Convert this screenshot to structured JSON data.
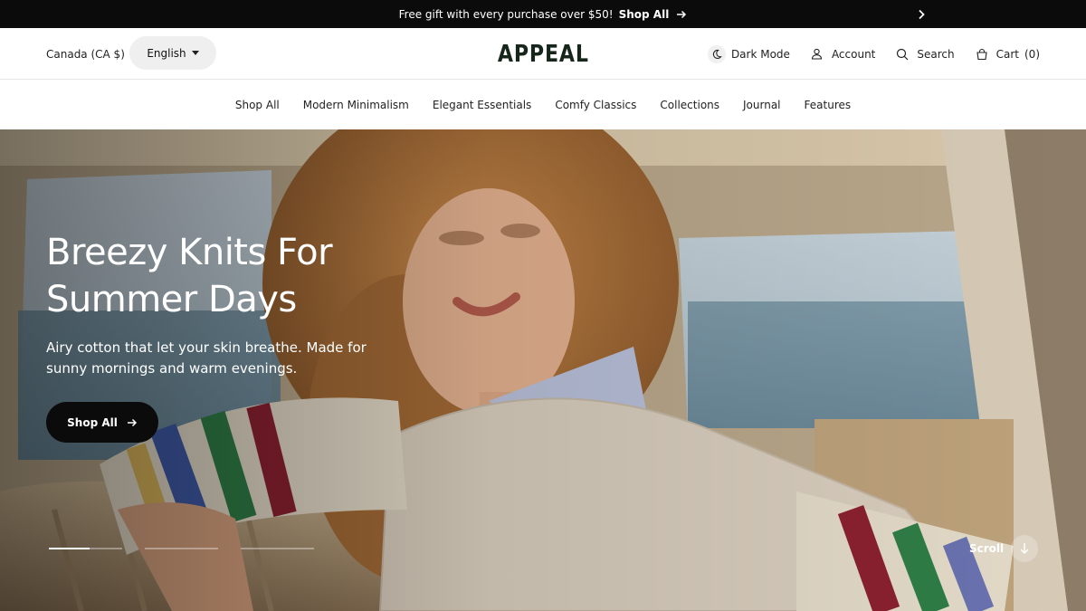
{
  "announcement": {
    "message": "Free gift with every purchase over $50!",
    "link_label": "Shop All"
  },
  "header": {
    "locale": "Canada (CA $)",
    "language": "English",
    "logo": "APPEAL",
    "tools": {
      "dark_mode": "Dark Mode",
      "account": "Account",
      "search": "Search",
      "cart": "Cart",
      "cart_count": "(0)"
    }
  },
  "nav": {
    "items": [
      "Shop All",
      "Modern Minimalism",
      "Elegant Essentials",
      "Comfy Classics",
      "Collections",
      "Journal",
      "Features"
    ]
  },
  "hero": {
    "title": "Breezy Knits For Summer Days",
    "subtitle": "Airy cotton that let your skin breathe. Made for sunny mornings and warm evenings.",
    "button_label": "Shop All",
    "scroll_label": "Scroll",
    "slides": [
      {
        "progress": 0.55
      },
      {
        "progress": 0
      },
      {
        "progress": 0
      }
    ]
  },
  "colors": {
    "announcement_bg": "#0b0b0b",
    "logo": "#16261b",
    "button_bg": "#0b0b0b"
  }
}
